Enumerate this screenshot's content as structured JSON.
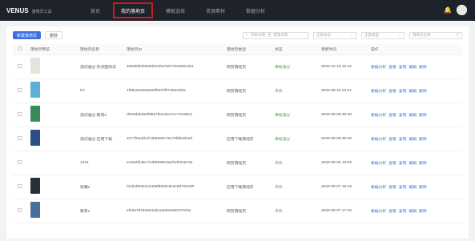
{
  "app": {
    "logo": "VENUS",
    "logo_sub": "落地页工具"
  },
  "nav": [
    {
      "label": "首页"
    },
    {
      "label": "我的落地页"
    },
    {
      "label": "模板选择"
    },
    {
      "label": "资源素材"
    },
    {
      "label": "数据分析"
    }
  ],
  "toolbar": {
    "create_label": "新建落地页",
    "delete_label": "删除"
  },
  "filters": {
    "start_date": "开始日期",
    "range_sep": "至",
    "end_date": "结束日期",
    "select1": "全部状态",
    "select2": "全部类型",
    "search": "落地页名称"
  },
  "table": {
    "headers": [
      "落地页预览",
      "落地页名称",
      "落地页ID",
      "落地页类型",
      "状态",
      "更新时间",
      "操作"
    ],
    "ops": [
      "数据分析",
      "查看",
      "复制",
      "编辑",
      "删除"
    ],
    "rows": [
      {
        "name": "测试通过-热点图测试",
        "id": "455def9d46e84b34be765779c8a0ceb3",
        "type": "网页落地页",
        "status": "审核通过",
        "status_ok": true,
        "time": "2020-10-19 16:42",
        "thumb": "#e8e2dc"
      },
      {
        "name": "iHi",
        "id": "1f58152a8a9426fb87bff7c80e260c",
        "type": "网页落地页",
        "status": "草稿",
        "status_ok": false,
        "time": "2020-09-16 20:01",
        "thumb": "#5ab0d8"
      },
      {
        "name": "测试通过-教育2",
        "id": "d633dde693fd9a7f84c8ea71c76c85c5",
        "type": "网页落地页",
        "status": "审核通过",
        "status_ok": true,
        "time": "2020-09-08 20:48",
        "thumb": "#3b8a5a"
      },
      {
        "name": "测试通过-应用下载",
        "id": "2277f9addcd74b6683c75c78bbbab3ef",
        "type": "应用下载落地页",
        "status": "审核通过",
        "status_ok": true,
        "time": "2020-09-08 20:48",
        "thumb": "#2e4b8a"
      },
      {
        "name": "1234",
        "id": "e4462fd45c724bb899e4aefad031573a",
        "type": "网页落地页",
        "status": "草稿",
        "status_ok": false,
        "time": "2020-09-08 18:03",
        "thumb": ""
      },
      {
        "name": "玩端2",
        "id": "01d23fe66112466f8820c9cdc8d7292d0",
        "type": "应用下载落地页",
        "status": "草稿",
        "status_ok": false,
        "time": "2020-09-07 19:19",
        "thumb": "#2a2f3a"
      },
      {
        "name": "教育1",
        "id": "ef33a7dc929e4adcaa06ee592370cbe",
        "type": "网页落地页",
        "status": "草稿",
        "status_ok": false,
        "time": "2020-09-07 17:18",
        "thumb": "#4a6f9a"
      }
    ]
  }
}
